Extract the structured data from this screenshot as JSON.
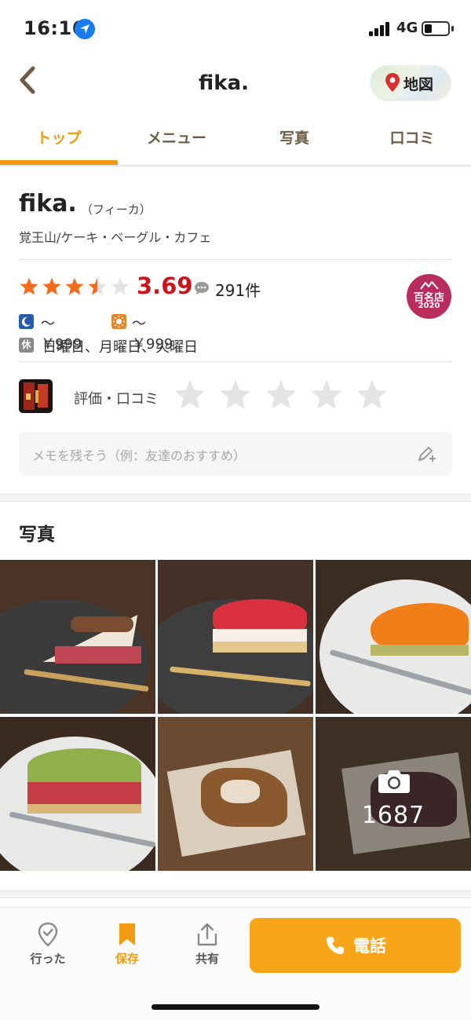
{
  "status_bar": {
    "time": "16:16",
    "network": "4G"
  },
  "nav": {
    "title": "fika.",
    "map_label": "地図"
  },
  "tabs": [
    {
      "label": "トップ",
      "active": true
    },
    {
      "label": "メニュー",
      "active": false
    },
    {
      "label": "写真",
      "active": false
    },
    {
      "label": "口コミ",
      "active": false
    }
  ],
  "shop": {
    "name": "fika.",
    "kana": "（フィーカ）",
    "genre": "覚王山/ケーキ・ベーグル・カフェ",
    "rating": "3.69",
    "rating_stars": 3.5,
    "review_count": "291件",
    "badge_text": "百名店",
    "badge_year": "2020",
    "dinner_price": "～￥999",
    "lunch_price": "～￥999",
    "holiday_icon": "休",
    "holidays": "日曜日、月曜日、火曜日"
  },
  "my_review": {
    "label": "評価・口コミ",
    "stars": 0
  },
  "memo": {
    "placeholder": "メモを残そう（例：友達のおすすめ）"
  },
  "photos": {
    "heading": "写真",
    "more_count": "1687"
  },
  "bottom_bar": {
    "visited_label": "行った",
    "saved_label": "保存",
    "share_label": "共有",
    "call_label": "電話"
  },
  "colors": {
    "accent": "#f29a11",
    "rating_red": "#d0121b",
    "star_orange": "#f26c1a",
    "badge": "#b82d5e",
    "call_button": "#f9a51a"
  }
}
